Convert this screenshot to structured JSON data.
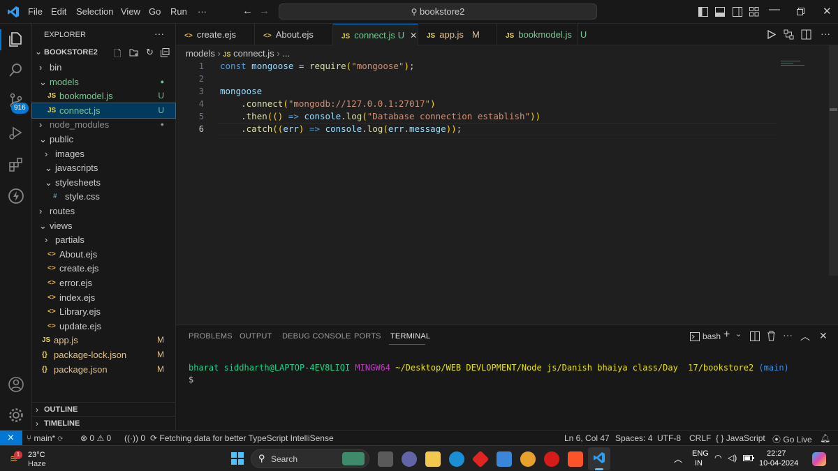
{
  "menu": [
    "File",
    "Edit",
    "Selection",
    "View",
    "Go",
    "Run",
    "···"
  ],
  "command_center": "bookstore2",
  "explorer": {
    "title": "EXPLORER",
    "more": "···",
    "root": "BOOKSTORE2",
    "items": [
      {
        "label": "bin",
        "indent": 1,
        "kind": "folder-closed",
        "icon": "›",
        "badge": "",
        "color": "#cccccc"
      },
      {
        "label": "models",
        "indent": 1,
        "kind": "folder-open",
        "icon": "⌄",
        "badge": "●",
        "color": "#73c991"
      },
      {
        "label": "bookmodel.js",
        "indent": 2,
        "kind": "js",
        "icon": "JS",
        "badge": "U",
        "color": "#73c991"
      },
      {
        "label": "connect.js",
        "indent": 2,
        "kind": "js",
        "icon": "JS",
        "badge": "U",
        "color": "#73c991"
      },
      {
        "label": "node_modules",
        "indent": 1,
        "kind": "folder-closed",
        "icon": "›",
        "badge": "●",
        "color": "#8c8c8c"
      },
      {
        "label": "public",
        "indent": 1,
        "kind": "folder-open",
        "icon": "⌄",
        "badge": "",
        "color": "#cccccc"
      },
      {
        "label": "images",
        "indent": 2,
        "kind": "folder-closed",
        "icon": "›",
        "badge": "",
        "color": "#cccccc"
      },
      {
        "label": "javascripts",
        "indent": 2,
        "kind": "folder-open",
        "icon": "⌄",
        "badge": "",
        "color": "#cccccc"
      },
      {
        "label": "stylesheets",
        "indent": 2,
        "kind": "folder-open",
        "icon": "⌄",
        "badge": "",
        "color": "#cccccc"
      },
      {
        "label": "style.css",
        "indent": 3,
        "kind": "css",
        "icon": "#",
        "badge": "",
        "color": "#cccccc"
      },
      {
        "label": "routes",
        "indent": 1,
        "kind": "folder-closed",
        "icon": "›",
        "badge": "",
        "color": "#cccccc"
      },
      {
        "label": "views",
        "indent": 1,
        "kind": "folder-open",
        "icon": "⌄",
        "badge": "",
        "color": "#cccccc"
      },
      {
        "label": "partials",
        "indent": 2,
        "kind": "folder-closed",
        "icon": "›",
        "badge": "",
        "color": "#cccccc"
      },
      {
        "label": "About.ejs",
        "indent": 2,
        "kind": "ejs",
        "icon": "<>",
        "badge": "",
        "color": "#cccccc"
      },
      {
        "label": "create.ejs",
        "indent": 2,
        "kind": "ejs",
        "icon": "<>",
        "badge": "",
        "color": "#cccccc"
      },
      {
        "label": "error.ejs",
        "indent": 2,
        "kind": "ejs",
        "icon": "<>",
        "badge": "",
        "color": "#cccccc"
      },
      {
        "label": "index.ejs",
        "indent": 2,
        "kind": "ejs",
        "icon": "<>",
        "badge": "",
        "color": "#cccccc"
      },
      {
        "label": "Library.ejs",
        "indent": 2,
        "kind": "ejs",
        "icon": "<>",
        "badge": "",
        "color": "#cccccc"
      },
      {
        "label": "update.ejs",
        "indent": 2,
        "kind": "ejs",
        "icon": "<>",
        "badge": "",
        "color": "#cccccc"
      },
      {
        "label": "app.js",
        "indent": 1,
        "kind": "js",
        "icon": "JS",
        "badge": "M",
        "color": "#e2c08d"
      },
      {
        "label": "package-lock.json",
        "indent": 1,
        "kind": "json",
        "icon": "{}",
        "badge": "M",
        "color": "#e2c08d"
      },
      {
        "label": "package.json",
        "indent": 1,
        "kind": "json",
        "icon": "{}",
        "badge": "M",
        "color": "#e2c08d"
      }
    ],
    "outline": "OUTLINE",
    "timeline": "TIMELINE"
  },
  "tabs": [
    {
      "label": "create.ejs",
      "icon": "<>",
      "badge": "",
      "color": "#cccccc",
      "active": false
    },
    {
      "label": "About.ejs",
      "icon": "<>",
      "badge": "",
      "color": "#cccccc",
      "active": false
    },
    {
      "label": "connect.js",
      "icon": "JS",
      "badge": "U",
      "color": "#73c991",
      "active": true,
      "close": "✕"
    },
    {
      "label": "app.js",
      "icon": "JS",
      "badge": "M",
      "color": "#e2c08d",
      "active": false
    },
    {
      "label": "bookmodel.js",
      "icon": "JS",
      "badge": "U",
      "color": "#73c991",
      "active": false
    }
  ],
  "breadcrumb": {
    "folder": "models",
    "file": "connect.js",
    "more": "..."
  },
  "code_lines": [
    {
      "n": "1",
      "text": "const mongoose = require(\"mongoose\");"
    },
    {
      "n": "2",
      "text": ""
    },
    {
      "n": "3",
      "text": "mongoose"
    },
    {
      "n": "4",
      "text": "    .connect(\"mongodb://127.0.0.1:27017\")"
    },
    {
      "n": "5",
      "text": "    .then(() => console.log(\"Database connection establish\"))"
    },
    {
      "n": "6",
      "text": "    .catch((err) => console.log(err.message));"
    }
  ],
  "panel": {
    "tabs": [
      "PROBLEMS",
      "OUTPUT",
      "DEBUG CONSOLE",
      "PORTS",
      "TERMINAL"
    ],
    "active": "TERMINAL",
    "shell": "bash",
    "prompt": {
      "user": "bharat siddharth@LAPTOP-4EV8LIQI",
      "env": "MINGW64",
      "path": "~/Desktop/WEB DEVLOPMENT/Node js/Danish bhaiya class/Day  17/bookstore2",
      "branch": "(main)",
      "symbol": "$"
    }
  },
  "status": {
    "branch": "main*",
    "errors": "0",
    "warnings": "0",
    "ports": "0",
    "message": "Fetching data for better TypeScript IntelliSense",
    "position": "Ln 6, Col 47",
    "spaces": "Spaces: 4",
    "encoding": "UTF-8",
    "eol": "CRLF",
    "language": "JavaScript",
    "golive": "Go Live"
  },
  "activity_badge": "916",
  "taskbar": {
    "weather_temp": "23°C",
    "weather_desc": "Haze",
    "weather_badge": "1",
    "search": "Search",
    "lang": "ENG",
    "region": "IN",
    "time": "22:27",
    "date": "10-04-2024"
  },
  "colors": {
    "accent": "#0078d4",
    "untracked": "#73c991",
    "modified": "#e2c08d",
    "keyword": "#569cd6",
    "string": "#ce9178",
    "function": "#dcdcaa",
    "variable": "#9cdcfe",
    "terminal_user": "#23d18b",
    "terminal_env": "#bc3fbc",
    "terminal_path": "#e5e510",
    "terminal_branch": "#3b8eea"
  }
}
